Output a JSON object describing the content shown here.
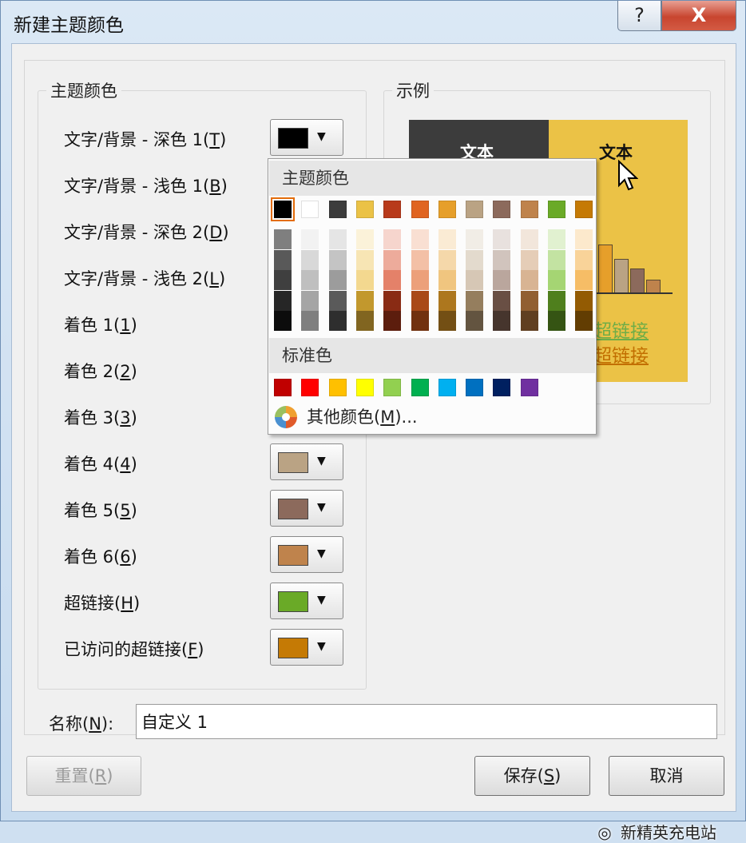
{
  "window": {
    "title": "新建主题颜色",
    "help_label": "?",
    "close_label": "X"
  },
  "theme_group": {
    "legend": "主题颜色",
    "rows": [
      {
        "label": "文字/背景 - 深色 1(",
        "key": "T",
        "end": ")",
        "color": "#000000"
      },
      {
        "label": "文字/背景 - 浅色 1(",
        "key": "B",
        "end": ")",
        "color": "#FFFFFF"
      },
      {
        "label": "文字/背景 - 深色 2(",
        "key": "D",
        "end": ")",
        "color": "#3C3C3C"
      },
      {
        "label": "文字/背景 - 浅色 2(",
        "key": "L",
        "end": ")",
        "color": "#EBC246"
      },
      {
        "label": "着色 1(",
        "key": "1",
        "end": ")",
        "color": "#B83A1B"
      },
      {
        "label": "着色 2(",
        "key": "2",
        "end": ")",
        "color": "#E06421"
      },
      {
        "label": "着色 3(",
        "key": "3",
        "end": ")",
        "color": "#E69F2A"
      },
      {
        "label": "着色 4(",
        "key": "4",
        "end": ")",
        "color": "#BAA384"
      },
      {
        "label": "着色 5(",
        "key": "5",
        "end": ")",
        "color": "#8C6A5C"
      },
      {
        "label": "着色 6(",
        "key": "6",
        "end": ")",
        "color": "#BF834C"
      },
      {
        "label": "超链接(",
        "key": "H",
        "end": ")",
        "color": "#6AAA27"
      },
      {
        "label": "已访问的超链接(",
        "key": "F",
        "end": ")",
        "color": "#C57A05"
      }
    ]
  },
  "sample_group": {
    "legend": "示例",
    "dark_text": "文本",
    "light_text": "文本",
    "link_text": "超链接",
    "visited_link_text": "超链接"
  },
  "name_field": {
    "label": "名称(",
    "key": "N",
    "end": "):",
    "value": "自定义 1"
  },
  "buttons": {
    "reset": {
      "label": "重置(",
      "key": "R",
      "end": ")"
    },
    "save": {
      "label": "保存(",
      "key": "S",
      "end": ")"
    },
    "cancel": {
      "label": "取消"
    }
  },
  "watermark": "新精英充电站",
  "color_popup": {
    "theme_header": "主题颜色",
    "standard_header": "标准色",
    "more_label": "其他颜色(",
    "more_key": "M",
    "more_end": ")...",
    "theme_base": [
      "#000000",
      "#FFFFFF",
      "#3C3C3C",
      "#EBC246",
      "#B83A1B",
      "#E06421",
      "#E69F2A",
      "#BAA384",
      "#8C6A5C",
      "#BF834C",
      "#6AAA27",
      "#C57A05"
    ],
    "theme_shades": [
      [
        "#7F7F7F",
        "#595959",
        "#3F3F3F",
        "#262626",
        "#0C0C0C"
      ],
      [
        "#F2F2F2",
        "#D8D8D8",
        "#BFBFBF",
        "#A5A5A5",
        "#7F7F7F"
      ],
      [
        "#E5E5E5",
        "#C4C4C4",
        "#9C9C9C",
        "#5A5A5A",
        "#2E2E2E"
      ],
      [
        "#FBF2D9",
        "#F7E5B4",
        "#F3D88F",
        "#C2982D",
        "#816520"
      ],
      [
        "#F6D5CD",
        "#EDAB9B",
        "#E48169",
        "#892B14",
        "#5C1D0D"
      ],
      [
        "#F9DFD2",
        "#F3C0A6",
        "#ECA07A",
        "#A94917",
        "#71310F"
      ],
      [
        "#FAEBD4",
        "#F5D8AA",
        "#F0C57F",
        "#AD771E",
        "#734F14"
      ],
      [
        "#F1EDE6",
        "#E3DACD",
        "#D6C7B5",
        "#957E5E",
        "#635440"
      ],
      [
        "#E8E1DE",
        "#D1C4BD",
        "#BAA69D",
        "#694F44",
        "#46352D"
      ],
      [
        "#F2E6DB",
        "#E5CDB7",
        "#D8B493",
        "#915F31",
        "#603F20"
      ],
      [
        "#E1F1D0",
        "#C3E3A2",
        "#A5D573",
        "#4F7F1D",
        "#355413"
      ],
      [
        "#FCE9CC",
        "#F9D399",
        "#F6BD66",
        "#935B03",
        "#623D02"
      ]
    ],
    "standard_colors": [
      "#C00000",
      "#FF0000",
      "#FFC000",
      "#FFFF00",
      "#92D050",
      "#00B050",
      "#00B0F0",
      "#0070C0",
      "#002060",
      "#7030A0"
    ]
  }
}
